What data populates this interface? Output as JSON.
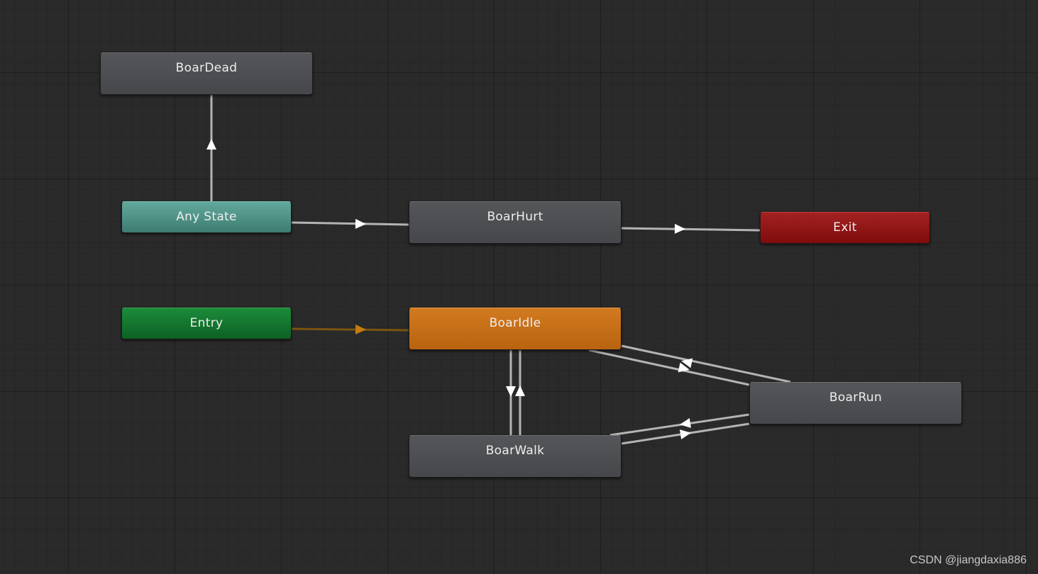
{
  "graph": {
    "nodes": {
      "boar_dead": "BoarDead",
      "any_state": "Any State",
      "boar_hurt": "BoarHurt",
      "exit": "Exit",
      "entry": "Entry",
      "boar_idle": "BoarIdle",
      "boar_run": "BoarRun",
      "boar_walk": "BoarWalk"
    },
    "transitions": [
      {
        "from": "Any State",
        "to": "BoarDead"
      },
      {
        "from": "Any State",
        "to": "BoarHurt"
      },
      {
        "from": "BoarHurt",
        "to": "Exit"
      },
      {
        "from": "Entry",
        "to": "BoarIdle",
        "default": true
      },
      {
        "from": "BoarIdle",
        "to": "BoarWalk"
      },
      {
        "from": "BoarWalk",
        "to": "BoarIdle"
      },
      {
        "from": "BoarIdle",
        "to": "BoarRun"
      },
      {
        "from": "BoarRun",
        "to": "BoarIdle"
      },
      {
        "from": "BoarWalk",
        "to": "BoarRun"
      },
      {
        "from": "BoarRun",
        "to": "BoarWalk"
      }
    ],
    "colors": {
      "background": "#2a2a2a",
      "transition": "#b4b4b4",
      "default_transition": "#7a5410",
      "arrow": "#ffffff",
      "default_arrow": "#c47d0e",
      "state": "#4b4d51",
      "default_state": "#c46c16",
      "any_state": "#4f9488",
      "entry": "#157a30",
      "exit": "#911616"
    }
  },
  "watermark": "CSDN @jiangdaxia886"
}
